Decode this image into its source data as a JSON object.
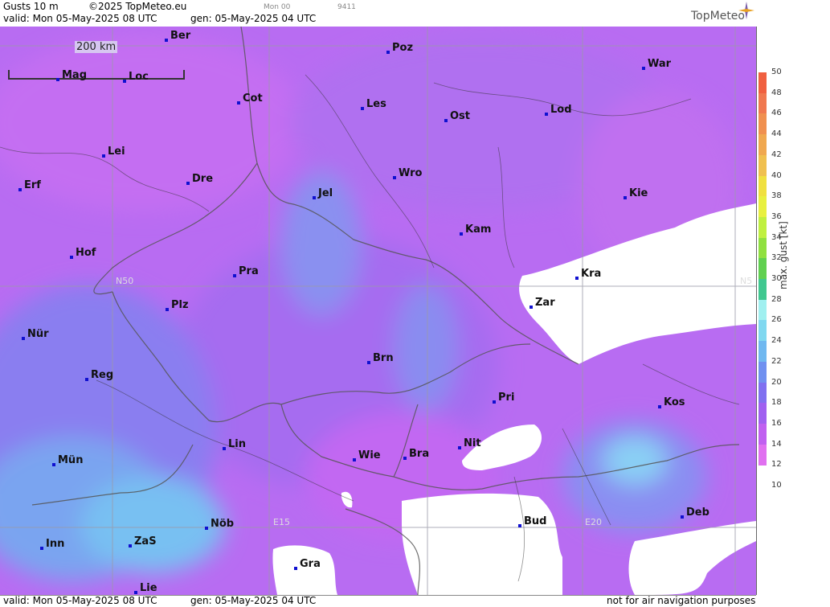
{
  "header": {
    "product": "Gusts 10 m",
    "copyright": "©2025 TopMeteo.eu",
    "valid": "valid:  Mon  05-May-2025  08 UTC",
    "gen": "gen: 05-May-2025 04 UTC",
    "run": "Mon 00",
    "code": "9411",
    "brand": "TopMeteo"
  },
  "footer": {
    "valid": "valid:  Mon  05-May-2025  08 UTC",
    "gen": "gen: 05-May-2025 04 UTC",
    "disclaimer": "not for air navigation purposes"
  },
  "scale_label": "200 km",
  "grid_labels": {
    "n50_left": "N50",
    "n50_right": "N5",
    "e15": "E15",
    "e20": "E20"
  },
  "cities": [
    "Ber",
    "Poz",
    "War",
    "Mag",
    "Loc",
    "Cot",
    "Les",
    "Ost",
    "Lod",
    "Lei",
    "Erf",
    "Dre",
    "Wro",
    "Jel",
    "Kie",
    "Kam",
    "Hof",
    "Pra",
    "Kra",
    "Zar",
    "Plz",
    "Nür",
    "Brn",
    "Reg",
    "Pri",
    "Kos",
    "Lin",
    "Nit",
    "Mün",
    "Wie",
    "Bra",
    "Bud",
    "Deb",
    "Nöb",
    "Inn",
    "ZaS",
    "Gra",
    "Lie"
  ],
  "legend": {
    "unit": "max. gust [kt]",
    "ticks": [
      "50",
      "48",
      "46",
      "44",
      "42",
      "40",
      "38",
      "36",
      "34",
      "32",
      "30",
      "28",
      "26",
      "24",
      "22",
      "20",
      "18",
      "16",
      "14",
      "12",
      "10"
    ],
    "colors": [
      "#f06040",
      "#f07850",
      "#f09050",
      "#f0a850",
      "#f0c050",
      "#f0e040",
      "#e8f040",
      "#c0f040",
      "#90e040",
      "#60d050",
      "#40c890",
      "#a0f0f0",
      "#80d8f0",
      "#70b8f0",
      "#7090f0",
      "#8070f0",
      "#a060f0",
      "#c060f0",
      "#e070f0"
    ]
  }
}
